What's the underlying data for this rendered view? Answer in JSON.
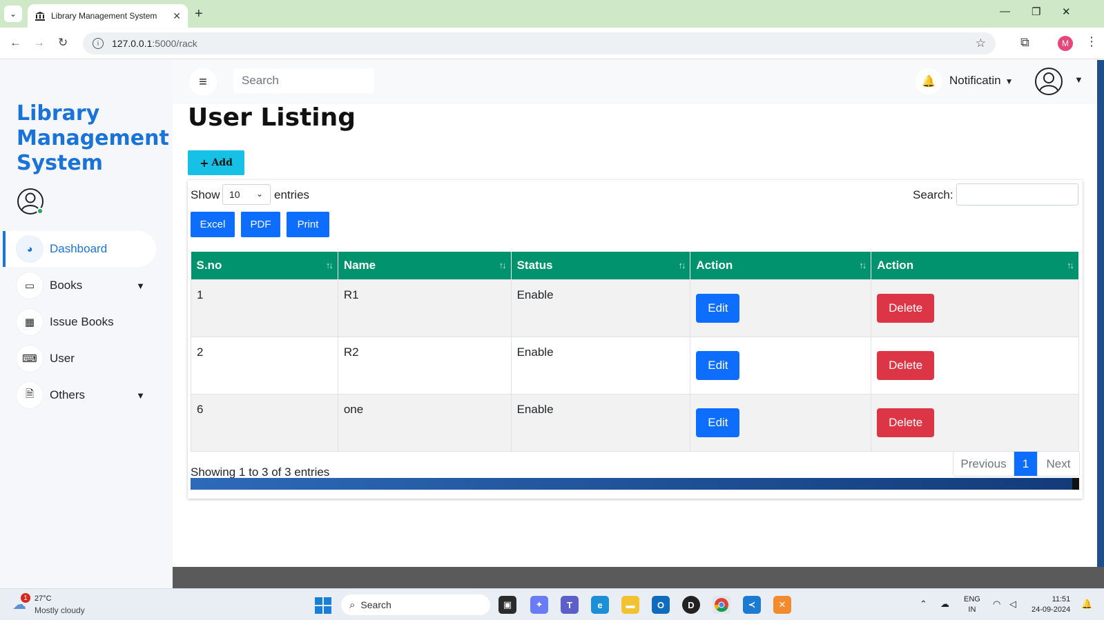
{
  "browser": {
    "tab_title": "Library Management System",
    "url_host": "127.0.0.1",
    "url_path": ":5000/rack",
    "profile_initial": "M"
  },
  "sidebar": {
    "brand": "Library Management System",
    "items": [
      {
        "label": "Dashboard",
        "icon": "gauge-icon",
        "active": true
      },
      {
        "label": "Books",
        "icon": "laptop-icon",
        "has_submenu": true
      },
      {
        "label": "Issue Books",
        "icon": "grid-icon"
      },
      {
        "label": "User",
        "icon": "keyboard-icon"
      },
      {
        "label": "Others",
        "icon": "document-icon",
        "has_submenu": true
      }
    ]
  },
  "topbar": {
    "search_placeholder": "Search",
    "notification_label": "Notificatin"
  },
  "page": {
    "title": "User Listing",
    "add_label": "Add"
  },
  "table_controls": {
    "show_label": "Show",
    "page_size": "10",
    "entries_label": "entries",
    "search_label": "Search:",
    "export_buttons": [
      "Excel",
      "PDF",
      "Print"
    ]
  },
  "table": {
    "columns": [
      "S.no",
      "Name",
      "Status",
      "Action",
      "Action"
    ],
    "rows": [
      {
        "sno": "1",
        "name": "R1",
        "status": "Enable",
        "edit": "Edit",
        "delete": "Delete"
      },
      {
        "sno": "2",
        "name": "R2",
        "status": "Enable",
        "edit": "Edit",
        "delete": "Delete"
      },
      {
        "sno": "6",
        "name": "one",
        "status": "Enable",
        "edit": "Edit",
        "delete": "Delete"
      }
    ],
    "info": "Showing 1 to 3 of 3 entries",
    "pagination": {
      "previous": "Previous",
      "current": "1",
      "next": "Next"
    }
  },
  "taskbar": {
    "weather_temp": "27°C",
    "weather_desc": "Mostly cloudy",
    "weather_badge": "1",
    "search_label": "Search",
    "lang_line1": "ENG",
    "lang_line2": "IN",
    "time": "11:51",
    "date": "24-09-2024"
  },
  "colors": {
    "brand_blue": "#1a73d9",
    "table_header": "#00936d",
    "add_button": "#17c1e6",
    "primary_button": "#0d6efd",
    "danger_button": "#dc3545"
  }
}
